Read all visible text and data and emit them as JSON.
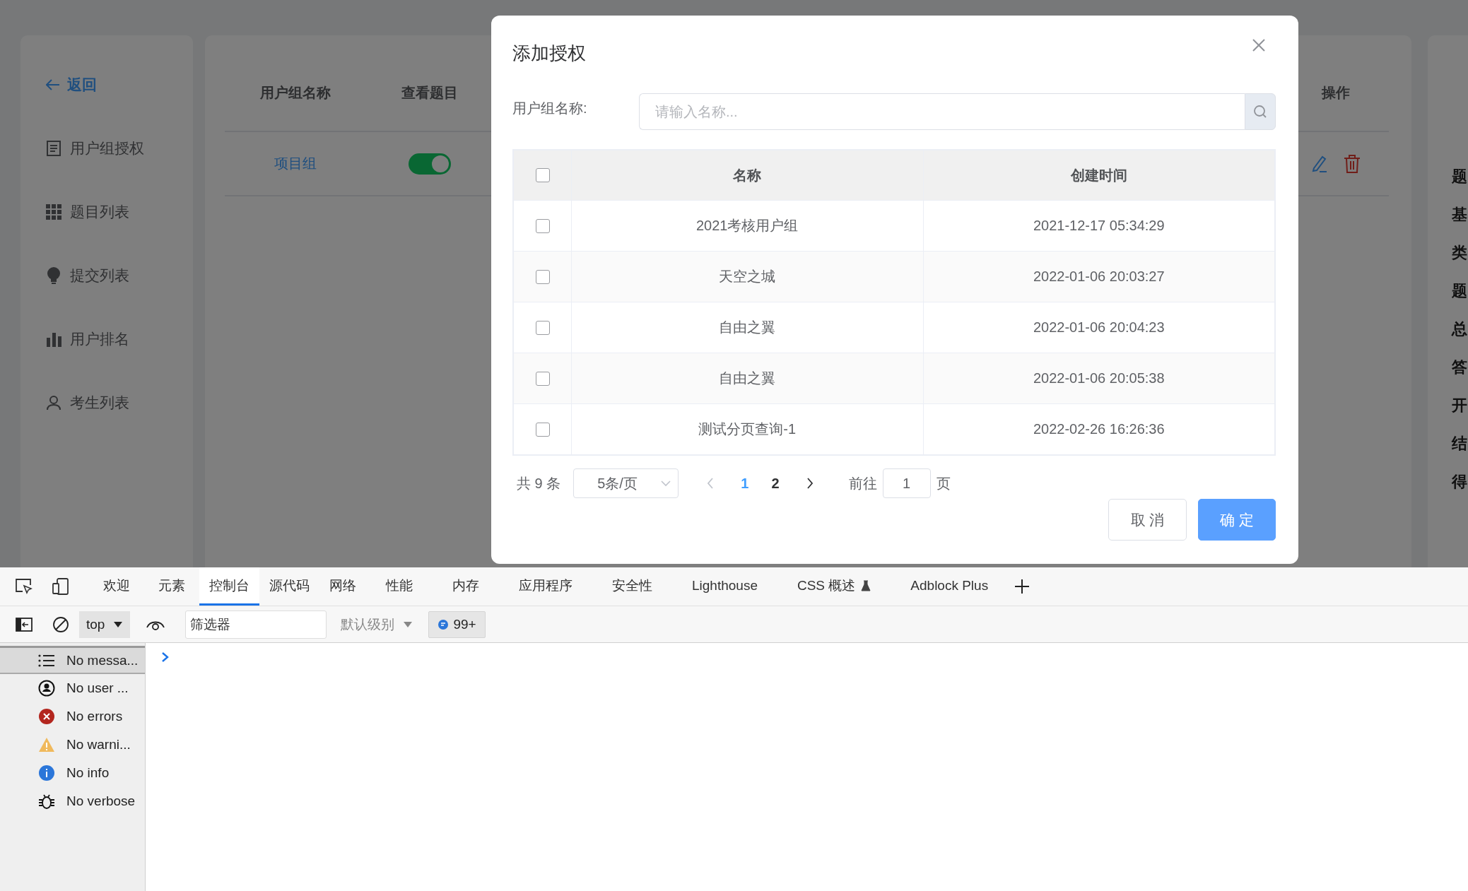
{
  "sidebar": {
    "back": "返回",
    "items": [
      {
        "label": "用户组授权"
      },
      {
        "label": "题目列表"
      },
      {
        "label": "提交列表"
      },
      {
        "label": "用户排名"
      },
      {
        "label": "考生列表"
      }
    ]
  },
  "group_table": {
    "columns": [
      "用户组名称",
      "查看题目",
      "操作"
    ],
    "rows": [
      {
        "name": "项目组",
        "view_questions_on": true
      }
    ]
  },
  "detail_panel": {
    "labels": [
      "题",
      "基",
      "类",
      "题",
      "总",
      "答",
      "开",
      "结",
      "得"
    ]
  },
  "dialog": {
    "title": "添加授权",
    "search": {
      "label": "用户组名称:",
      "placeholder": "请输入名称..."
    },
    "table": {
      "columns": [
        "名称",
        "创建时间"
      ],
      "all_checked": false,
      "rows": [
        {
          "name": "2021考核用户组",
          "created": "2021-12-17 05:34:29",
          "checked": false
        },
        {
          "name": "天空之城",
          "created": "2022-01-06 20:03:27",
          "checked": false
        },
        {
          "name": "自由之翼",
          "created": "2022-01-06 20:04:23",
          "checked": false
        },
        {
          "name": "自由之翼",
          "created": "2022-01-06 20:05:38",
          "checked": false
        },
        {
          "name": "测试分页查询-1",
          "created": "2022-02-26 16:26:36",
          "checked": false
        }
      ]
    },
    "pagination": {
      "total": "共 9 条",
      "page_size": "5条/页",
      "pages": [
        {
          "label": "1",
          "selected": true
        },
        {
          "label": "2",
          "selected": false
        }
      ],
      "goto_label": "前往",
      "goto_value": "1",
      "goto_suffix": "页"
    },
    "buttons": [
      {
        "label": "取 消",
        "kind": "default"
      },
      {
        "label": "确 定",
        "kind": "primary"
      }
    ]
  },
  "devtools": {
    "tabs": [
      {
        "label": "欢迎",
        "selected": false
      },
      {
        "label": "元素",
        "selected": false
      },
      {
        "label": "控制台",
        "selected": true
      },
      {
        "label": "源代码",
        "selected": false
      },
      {
        "label": "网络",
        "selected": false
      },
      {
        "label": "性能",
        "selected": false
      },
      {
        "label": "内存",
        "selected": false
      },
      {
        "label": "应用程序",
        "selected": false
      },
      {
        "label": "安全性",
        "selected": false
      },
      {
        "label": "Lighthouse",
        "selected": false
      },
      {
        "label": "CSS 概述",
        "selected": false,
        "kind": "experimental"
      },
      {
        "label": "Adblock Plus",
        "selected": false
      }
    ],
    "context": "top",
    "filter_placeholder": "筛选器",
    "level": "默认级别",
    "issues_badge": "99+",
    "sidebar": [
      {
        "label": "No messa...",
        "kind": "messages",
        "selected": true
      },
      {
        "label": "No user ...",
        "kind": "user",
        "selected": false
      },
      {
        "label": "No errors",
        "kind": "error",
        "selected": false
      },
      {
        "label": "No warni...",
        "kind": "warning",
        "selected": false
      },
      {
        "label": "No info",
        "kind": "info",
        "selected": false
      },
      {
        "label": "No verbose",
        "kind": "verbose",
        "selected": false
      }
    ]
  }
}
